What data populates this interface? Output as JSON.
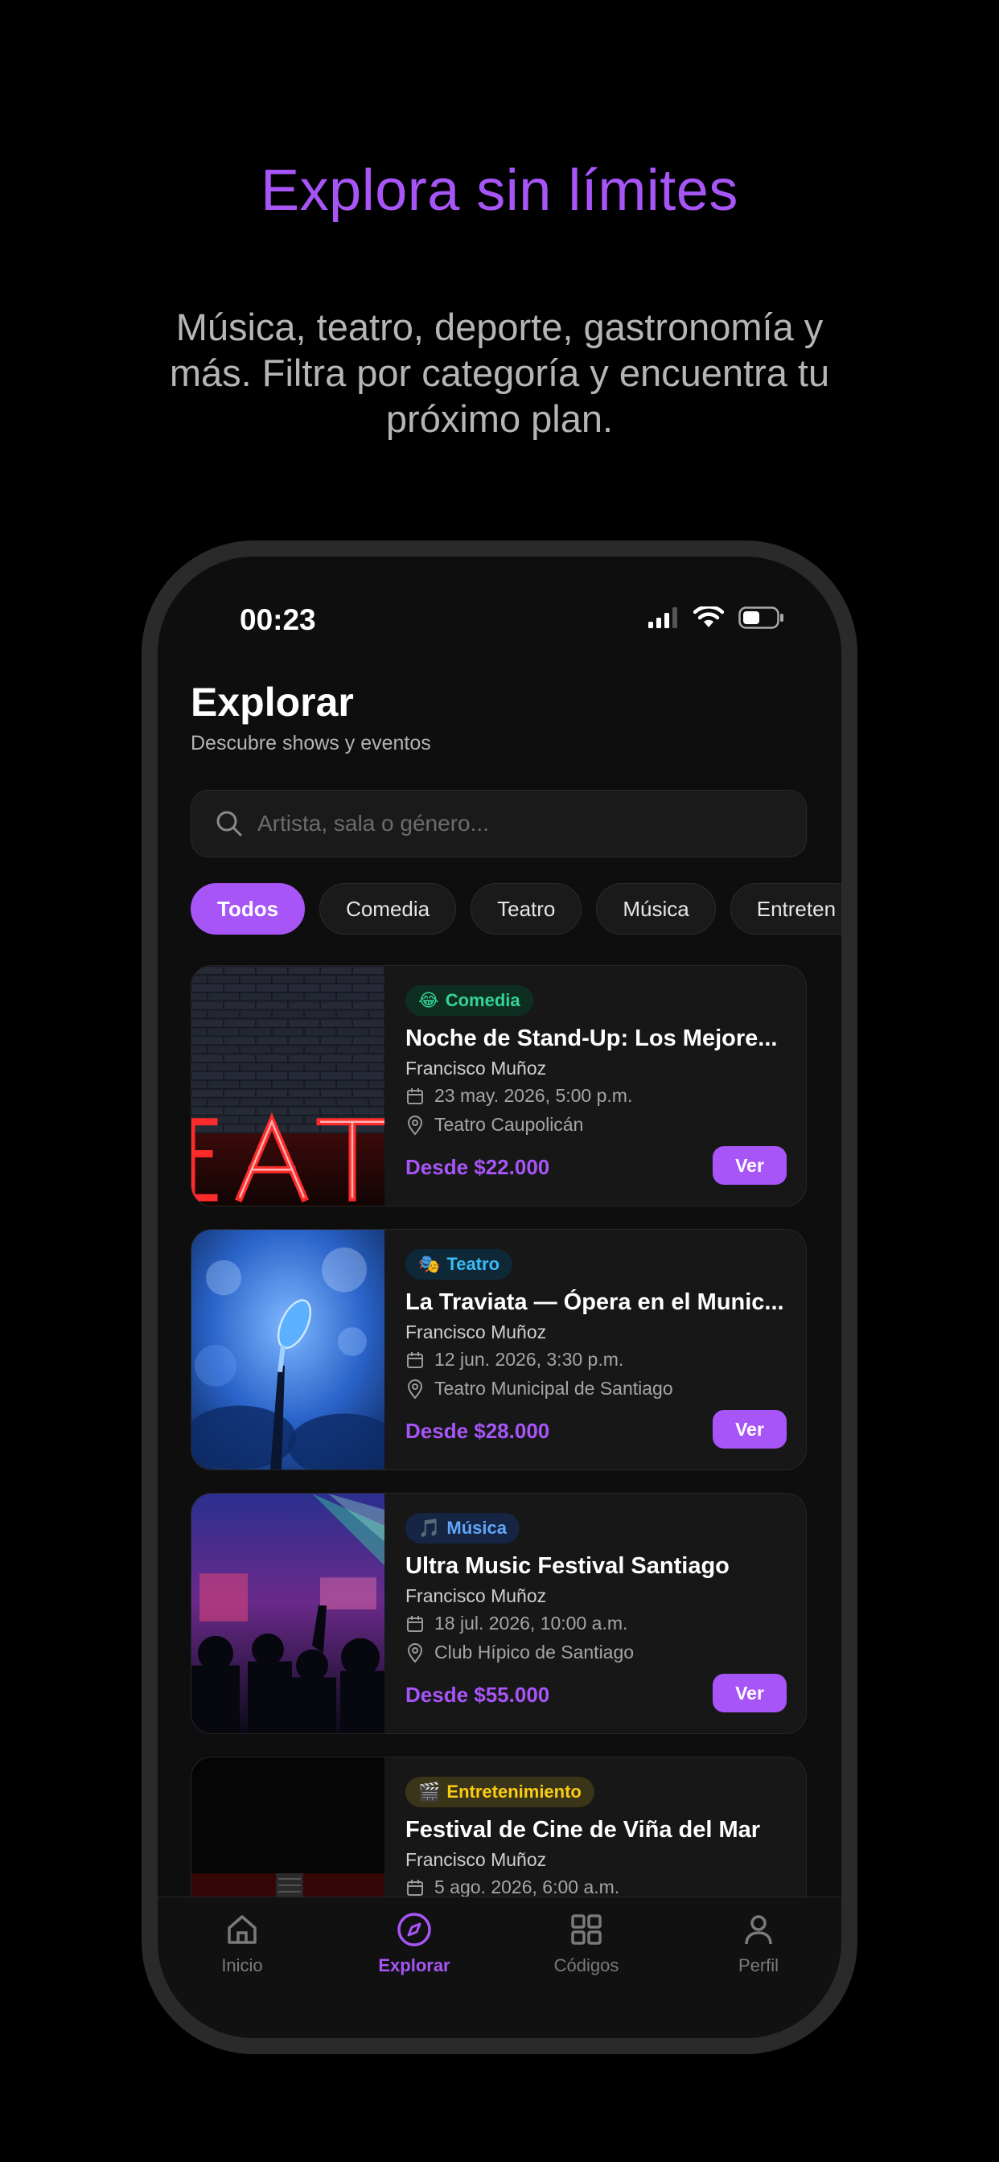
{
  "hero": {
    "title": "Explora sin límites",
    "subtitle": "Música, teatro, deporte, gastronomía y más. Filtra por categoría y encuentra tu próximo plan."
  },
  "status_bar": {
    "time": "00:23"
  },
  "header": {
    "title": "Explorar",
    "subtitle": "Descubre shows y eventos"
  },
  "search": {
    "placeholder": "Artista, sala o género..."
  },
  "categories": [
    "Todos",
    "Comedia",
    "Teatro",
    "Música",
    "Entreten"
  ],
  "active_category": "Todos",
  "events": [
    {
      "badge": "Comedia",
      "badge_emoji": "😂",
      "badge_color": "#34d399",
      "title": "Noche de Stand-Up: Los Mejore...",
      "organizer": "Francisco Muñoz",
      "date": "23 may. 2026, 5:00 p.m.",
      "venue": "Teatro Caupolicán",
      "price": "Desde $22.000",
      "button": "Ver"
    },
    {
      "badge": "Teatro",
      "badge_emoji": "🎭",
      "badge_color": "#38bdf8",
      "title": "La Traviata — Ópera en el Munic...",
      "organizer": "Francisco Muñoz",
      "date": "12 jun. 2026, 3:30 p.m.",
      "venue": "Teatro Municipal de Santiago",
      "price": "Desde $28.000",
      "button": "Ver"
    },
    {
      "badge": "Música",
      "badge_emoji": "🎵",
      "badge_color": "#60a5fa",
      "title": "Ultra Music Festival Santiago",
      "organizer": "Francisco Muñoz",
      "date": "18 jul. 2026, 10:00 a.m.",
      "venue": "Club Hípico de Santiago",
      "price": "Desde $55.000",
      "button": "Ver"
    },
    {
      "badge": "Entretenimiento",
      "badge_emoji": "🎬",
      "badge_color": "#facc15",
      "title": "Festival de Cine de Viña del Mar",
      "organizer": "Francisco Muñoz",
      "date": "5 ago. 2026, 6:00 a.m.",
      "venue": "",
      "price": "",
      "button": ""
    }
  ],
  "bottom_nav": [
    {
      "label": "Inicio",
      "icon": "home-icon"
    },
    {
      "label": "Explorar",
      "icon": "compass-icon",
      "active": true
    },
    {
      "label": "Códigos",
      "icon": "grid-icon"
    },
    {
      "label": "Perfil",
      "icon": "user-icon"
    }
  ],
  "colors": {
    "accent": "#a855f7",
    "background": "#0e0e0e",
    "card": "#171717"
  }
}
